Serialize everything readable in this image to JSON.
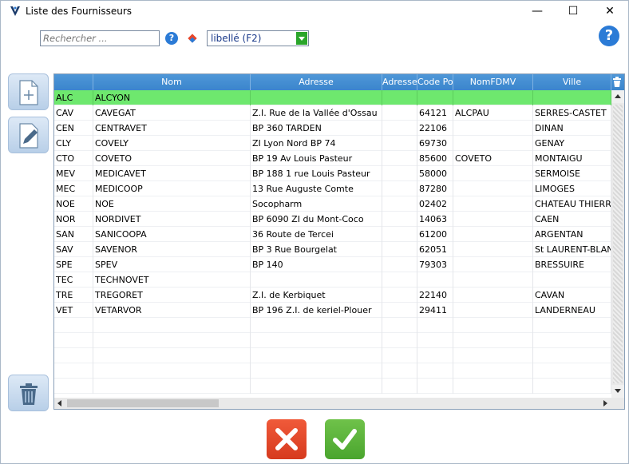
{
  "window": {
    "title": "Liste des  Fournisseurs",
    "minimize_glyph": "—",
    "maximize_glyph": "☐",
    "close_glyph": "✕"
  },
  "toolbar": {
    "search_placeholder": "Rechercher ...",
    "help_small": "?",
    "combo_value": "libellé (F2)",
    "help_big": "?"
  },
  "grid": {
    "columns": [
      "",
      "Nom",
      "Adresse",
      "Adresse",
      "Code Po",
      "NomFDMV",
      "Ville"
    ],
    "rows": [
      [
        "ALC",
        "ALCYON",
        "",
        "",
        "",
        "",
        ""
      ],
      [
        "CAV",
        "CAVEGAT",
        "Z.I. Rue de la Vallée d'Ossau",
        "",
        "64121",
        "ALCPAU",
        "SERRES-CASTET"
      ],
      [
        "CEN",
        "CENTRAVET",
        "BP 360 TARDEN",
        "",
        "22106",
        "",
        "DINAN"
      ],
      [
        "CLY",
        "COVELY",
        "ZI Lyon Nord BP 74",
        "",
        "69730",
        "",
        "GENAY"
      ],
      [
        "CTO",
        "COVETO",
        "BP 19 Av Louis Pasteur",
        "",
        "85600",
        "COVETO",
        "MONTAIGU"
      ],
      [
        "MEV",
        "MEDICAVET",
        "BP 188 1 rue Louis Pasteur",
        "",
        "58000",
        "",
        "SERMOISE"
      ],
      [
        "MEC",
        "MEDICOOP",
        "13 Rue Auguste Comte",
        "",
        "87280",
        "",
        "LIMOGES"
      ],
      [
        "NOE",
        "NOE",
        "Socopharm",
        "",
        "02402",
        "",
        "CHATEAU THIERRY"
      ],
      [
        "NOR",
        "NORDIVET",
        "BP 6090 ZI du Mont-Coco",
        "",
        "14063",
        "",
        "CAEN"
      ],
      [
        "SAN",
        "SANICOOPA",
        "36 Route de Tercei",
        "",
        "61200",
        "",
        "ARGENTAN"
      ],
      [
        "SAV",
        "SAVENOR",
        "BP 3 Rue Bourgelat",
        "",
        "62051",
        "",
        "St LAURENT-BLANGY"
      ],
      [
        "SPE",
        "SPEV",
        "BP 140",
        "",
        "79303",
        "",
        "BRESSUIRE"
      ],
      [
        "TEC",
        "TECHNOVET",
        "",
        "",
        "",
        "",
        ""
      ],
      [
        "TRE",
        "TREGORET",
        "Z.I. de Kerbiquet",
        "",
        "22140",
        "",
        "CAVAN"
      ],
      [
        "VET",
        "VETARVOR",
        "BP 196 Z.I. de keriel-Plouer",
        "",
        "29411",
        "",
        "LANDERNEAU"
      ]
    ],
    "empty_rows": 5,
    "selected_row": 0,
    "colors": {
      "header": "#3b85cc",
      "selected": "#6ee86e"
    }
  },
  "icons": {
    "side": [
      "new-document-icon",
      "edit-icon",
      "trash-icon"
    ],
    "bottom": [
      "cancel-icon",
      "validate-icon"
    ]
  }
}
